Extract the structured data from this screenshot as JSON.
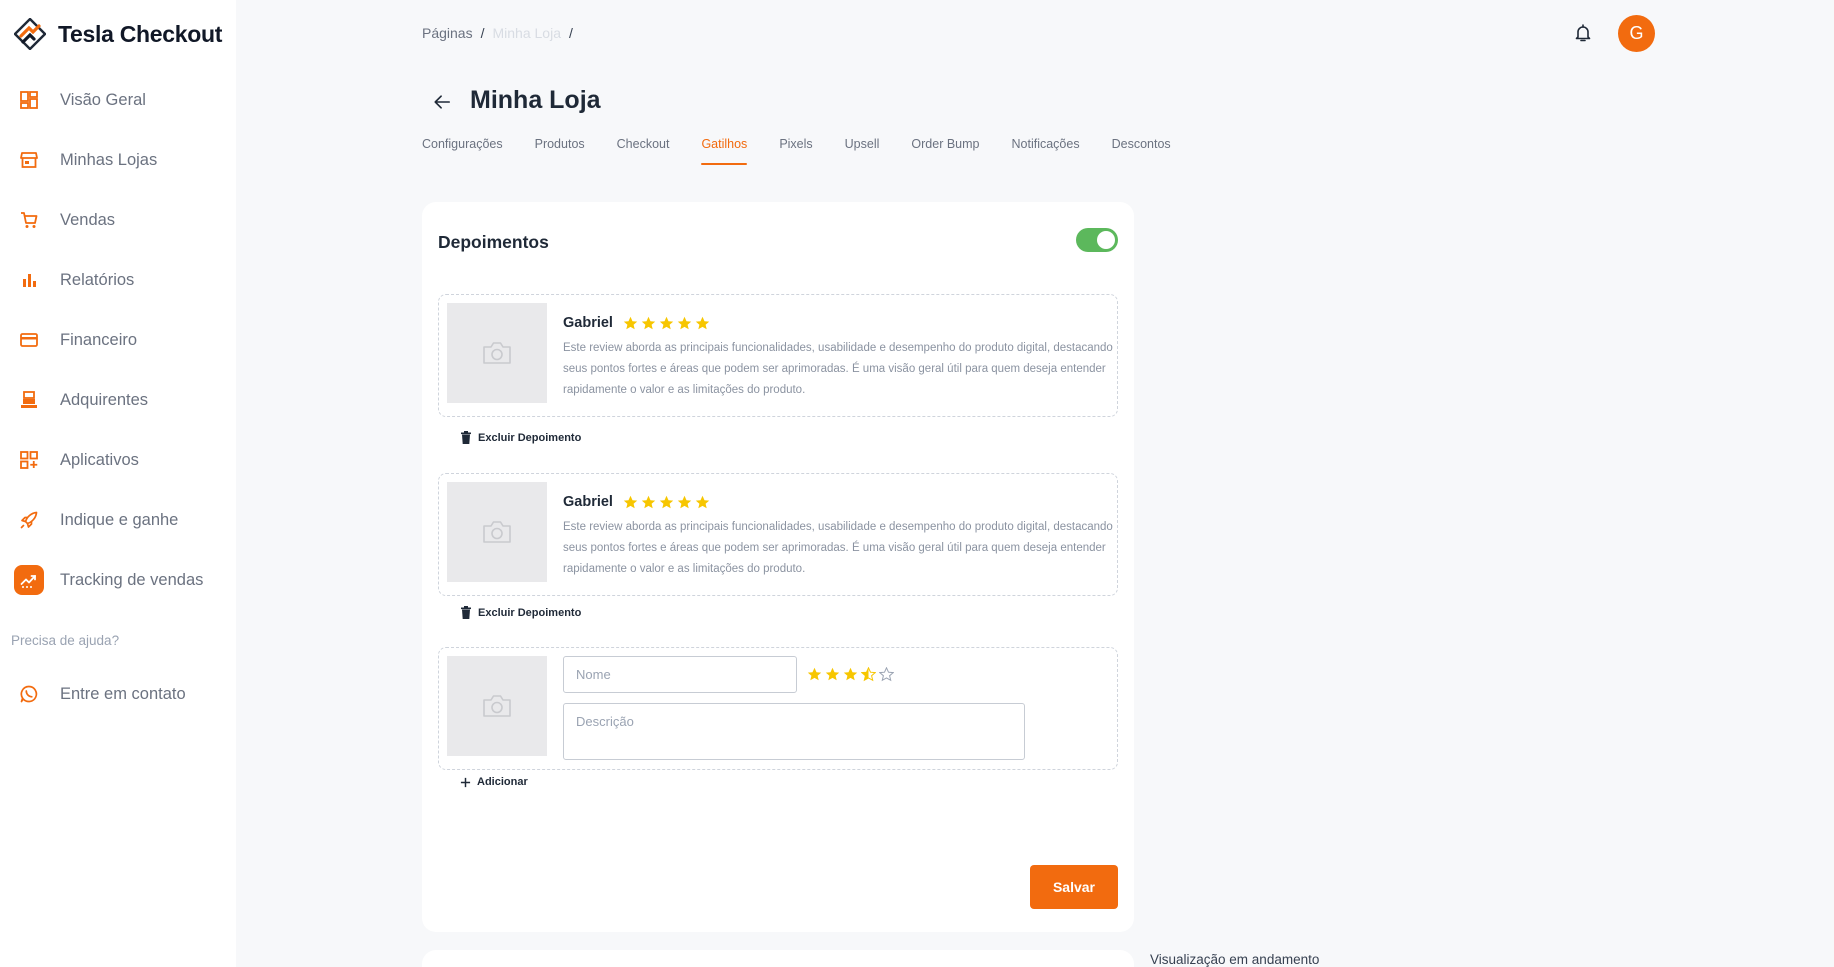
{
  "brand": {
    "name": "Tesla Checkout"
  },
  "sidebar": {
    "items": [
      {
        "label": "Visão Geral",
        "icon": "dashboard-icon"
      },
      {
        "label": "Minhas Lojas",
        "icon": "store-icon"
      },
      {
        "label": "Vendas",
        "icon": "cart-icon"
      },
      {
        "label": "Relatórios",
        "icon": "bar-chart-icon"
      },
      {
        "label": "Financeiro",
        "icon": "credit-card-icon"
      },
      {
        "label": "Adquirentes",
        "icon": "register-icon"
      },
      {
        "label": "Aplicativos",
        "icon": "apps-icon"
      },
      {
        "label": "Indique e ganhe",
        "icon": "rocket-icon"
      },
      {
        "label": "Tracking de vendas",
        "icon": "tracking-icon",
        "active": true
      }
    ],
    "help_label": "Precisa de ajuda?",
    "contact_label": "Entre em contato"
  },
  "breadcrumb": {
    "root": "Páginas",
    "current": "Minha Loja",
    "separator": "/"
  },
  "header": {
    "avatar_initial": "G"
  },
  "page": {
    "title": "Minha Loja"
  },
  "tabs": [
    {
      "label": "Configurações"
    },
    {
      "label": "Produtos"
    },
    {
      "label": "Checkout"
    },
    {
      "label": "Gatilhos",
      "active": true
    },
    {
      "label": "Pixels"
    },
    {
      "label": "Upsell"
    },
    {
      "label": "Order Bump"
    },
    {
      "label": "Notificações"
    },
    {
      "label": "Descontos"
    }
  ],
  "testimonials": {
    "title": "Depoimentos",
    "enabled": true,
    "reviews": [
      {
        "name": "Gabriel",
        "rating": 5,
        "text": "Este review aborda as principais funcionalidades, usabilidade e desempenho do produto digital, destacando seus pontos fortes e áreas que podem ser aprimoradas. É uma visão geral útil para quem deseja entender rapidamente o valor e as limitações do produto."
      },
      {
        "name": "Gabriel",
        "rating": 5,
        "text": "Este review aborda as principais funcionalidades, usabilidade e desempenho do produto digital, destacando seus pontos fortes e áreas que podem ser aprimoradas. É uma visão geral útil para quem deseja entender rapidamente o valor e as limitações do produto."
      }
    ],
    "delete_label": "Excluir Depoimento",
    "new_review": {
      "name_placeholder": "Nome",
      "description_placeholder": "Descrição",
      "rating": 3.5
    },
    "add_label": "Adicionar",
    "save_label": "Salvar"
  },
  "preview": {
    "label": "Visualização em andamento"
  },
  "colors": {
    "accent": "#f26b0f",
    "toggle_on": "#5cb85c",
    "star": "#f7c600"
  }
}
